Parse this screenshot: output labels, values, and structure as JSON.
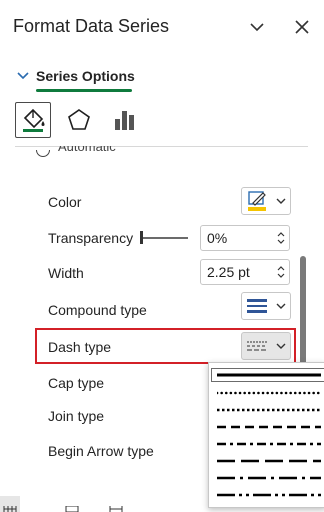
{
  "pane": {
    "title": "Format Data Series"
  },
  "section": {
    "label": "Series Options"
  },
  "partial_option": {
    "label": "Automatic"
  },
  "rows": {
    "color": "Color",
    "transparency": "Transparency",
    "width": "Width",
    "compound_type": "Compound type",
    "dash_type": "Dash type",
    "cap_type": "Cap type",
    "join_type": "Join type",
    "begin_arrow_type": "Begin Arrow type"
  },
  "controls": {
    "transparency_value": "0%",
    "width_value": "2.25 pt"
  },
  "colors": {
    "accent_green": "#0f7b3d",
    "highlight_red": "#d32027",
    "pen_yellow": "#f5c400",
    "line_blue": "#2f5597"
  },
  "icons": {
    "collapse": "chevron-down-icon",
    "close": "close-icon",
    "fill_line_tab": "paint-bucket-icon",
    "effects_tab": "pentagon-icon",
    "series_options_tab": "bar-chart-icon"
  },
  "dash_options": [
    "solid",
    "round-dot",
    "square-dot",
    "dash",
    "dash-dot",
    "long-dash",
    "long-dash-dot",
    "long-dash-dot-dot"
  ]
}
